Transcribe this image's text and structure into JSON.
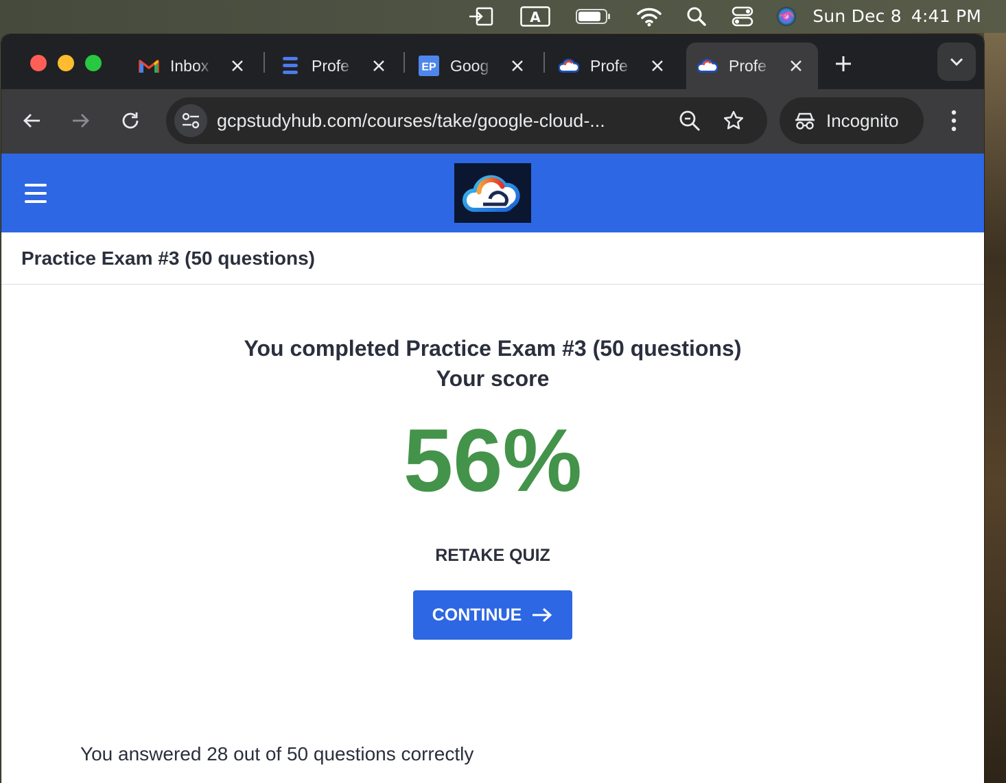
{
  "menubar": {
    "date": "Sun Dec 8",
    "time": "4:41 PM",
    "icons": [
      "input-icon",
      "keyboard-a-icon",
      "battery-icon",
      "wifi-icon",
      "spotlight-search-icon",
      "control-center-icon",
      "siri-icon"
    ]
  },
  "tabs": [
    {
      "label": "Inbox",
      "favicon": "gmail-icon",
      "active": false
    },
    {
      "label": "Profe",
      "favicon": "document-icon",
      "active": false
    },
    {
      "label": "Goog",
      "favicon": "ep-icon",
      "favicon_text": "EP",
      "active": false
    },
    {
      "label": "Profe",
      "favicon": "cloud-logo-icon",
      "active": false
    },
    {
      "label": "Profe",
      "favicon": "cloud-logo-icon",
      "active": true
    }
  ],
  "toolbar": {
    "url": "gcpstudyhub.com/courses/take/google-cloud-...",
    "incognito_label": "Incognito"
  },
  "page": {
    "course_title": "Practice Exam #3 (50 questions)",
    "completed_line": "You completed Practice Exam #3 (50 questions)",
    "score_label": "Your score",
    "score": "56%",
    "retake_label": "RETAKE QUIZ",
    "continue_label": "CONTINUE",
    "answered_text": "You answered 28 out of 50 questions correctly"
  },
  "colors": {
    "brand_blue": "#2d67e3",
    "score_green": "#44934a",
    "text_dark": "#2b2f3d"
  }
}
